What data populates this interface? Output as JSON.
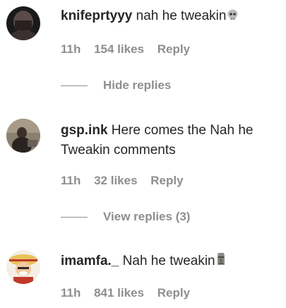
{
  "comments": [
    {
      "username": "knifeprtyyy",
      "text": "nah he tweakin",
      "emoji": "skull-emoji",
      "time": "11h",
      "likes": "154 likes",
      "reply": "Reply",
      "replies_toggle": "Hide replies"
    },
    {
      "username": "gsp.ink",
      "text_line1": "Here comes the Nah he",
      "text_line2": "Tweakin comments",
      "time": "11h",
      "likes": "32 likes",
      "reply": "Reply",
      "replies_toggle": "View replies (3)"
    },
    {
      "username": "imamfa._",
      "text": "Nah he tweakin",
      "emoji": "moai-emoji",
      "time": "11h",
      "likes": "841 likes",
      "reply": "Reply"
    }
  ],
  "colors": {
    "text": "#262626",
    "secondary": "#8e8e8e"
  }
}
